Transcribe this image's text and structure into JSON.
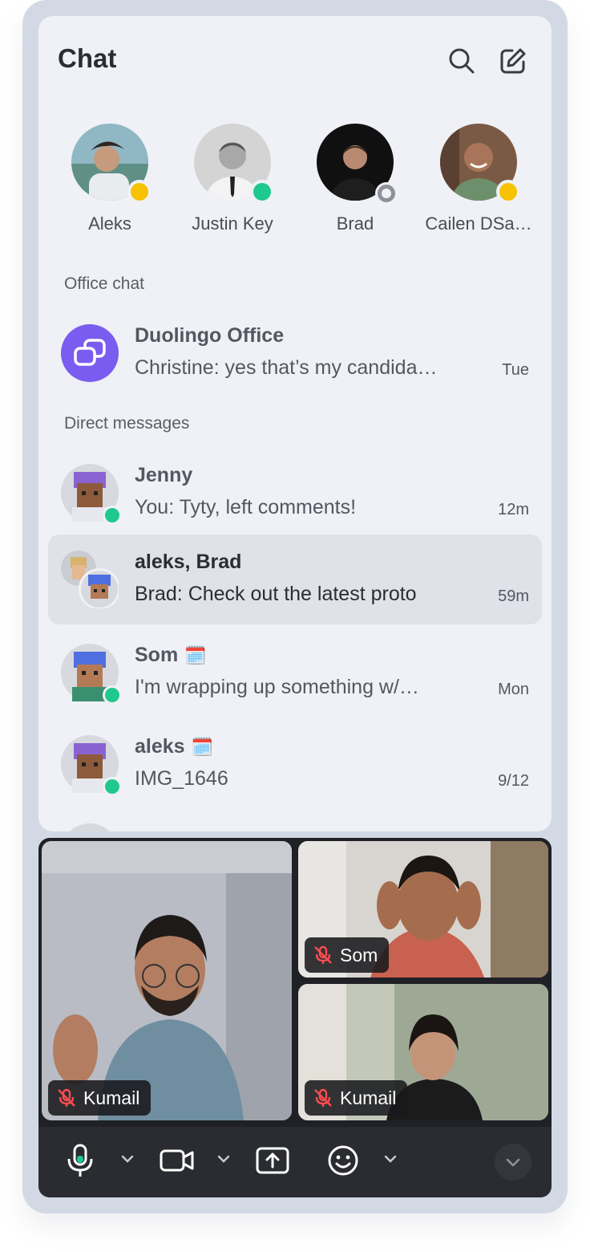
{
  "header": {
    "title": "Chat"
  },
  "stories": [
    {
      "name": "Aleks",
      "status": "away",
      "status_color": "#f7c200"
    },
    {
      "name": "Justin Key",
      "status": "online",
      "status_color": "#1fc98e"
    },
    {
      "name": "Brad",
      "status": "offline",
      "status_color": "#8e9199"
    },
    {
      "name": "Cailen DSa…",
      "status": "away",
      "status_color": "#f7c200"
    }
  ],
  "office_chat": {
    "label": "Office chat",
    "item": {
      "name": "Duolingo Office",
      "message": "Christine: yes that’s my candida…",
      "time": "Tue",
      "icon": "chat-bubbles-icon"
    }
  },
  "direct_messages": {
    "label": "Direct messages",
    "items": [
      {
        "name": "Jenny",
        "message": "You: Tyty, left comments!",
        "time": "12m",
        "online": true
      },
      {
        "name": "aleks, Brad",
        "message": "Brad: Check out the latest proto",
        "time": "59m",
        "selected": true
      },
      {
        "name": "Som",
        "badge": "🗓️",
        "message": "I'm wrapping up something w/…",
        "time": "Mon",
        "online": true
      },
      {
        "name": "aleks",
        "badge": "🗓️",
        "message": "IMG_1646",
        "time": "9/12",
        "online": true
      }
    ]
  },
  "call": {
    "participants": [
      {
        "name": "Kumail",
        "muted": true
      },
      {
        "name": "Som",
        "muted": true
      },
      {
        "name": "Kumail",
        "muted": true
      }
    ],
    "toolbar": [
      "microphone-icon",
      "camera-icon",
      "share-screen-icon",
      "emoji-icon",
      "collapse-icon"
    ]
  },
  "colors": {
    "accent": "#7a5cf0",
    "online": "#1fc98e",
    "away": "#f7c200",
    "muted_icon": "#ff4d4f"
  }
}
